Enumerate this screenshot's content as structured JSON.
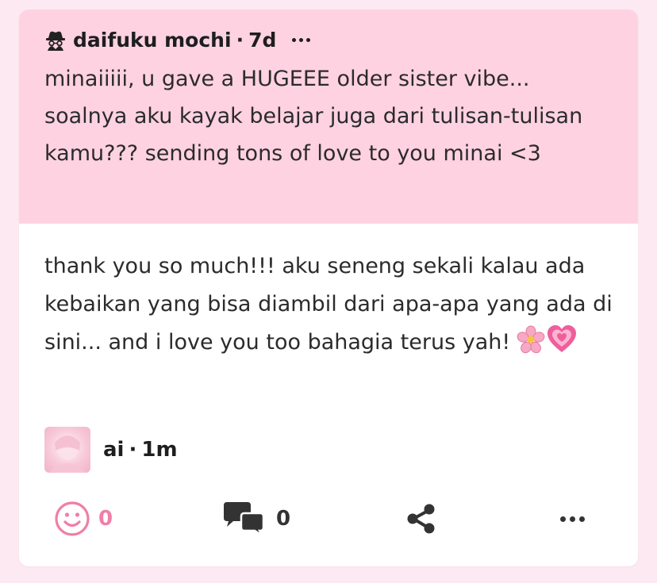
{
  "question": {
    "author": "daifuku mochi",
    "separator": "·",
    "time": "7d",
    "text": "minaiiiii, u gave a HUGEEE older sister vibe... soalnya aku kayak belajar juga dari tulisan-tulisan kamu??? sending tons of love to you minai <3",
    "icons": {
      "author": "anonymous-spy-icon",
      "menu": "more-horizontal-icon"
    }
  },
  "answer": {
    "text": "thank you so much!!! aku seneng sekali kalau ada kebaikan yang bisa diambil dari apa-apa yang ada di sini... and i love you too bahagia terus yah!",
    "emojis": [
      "cherry-blossom-icon",
      "growing-heart-icon"
    ]
  },
  "answerer": {
    "name": "ai",
    "separator": "·",
    "time": "1m"
  },
  "actions": {
    "reactions_count": "0",
    "comments_count": "0",
    "icons": [
      "smile-icon",
      "comments-icon",
      "share-icon",
      "more-horizontal-icon"
    ]
  },
  "colors": {
    "background": "#fde9f1",
    "question_bg": "#ffd2e2",
    "card_bg": "#ffffff",
    "accent_pink": "#f07ea8",
    "text": "#2b2b2b"
  }
}
